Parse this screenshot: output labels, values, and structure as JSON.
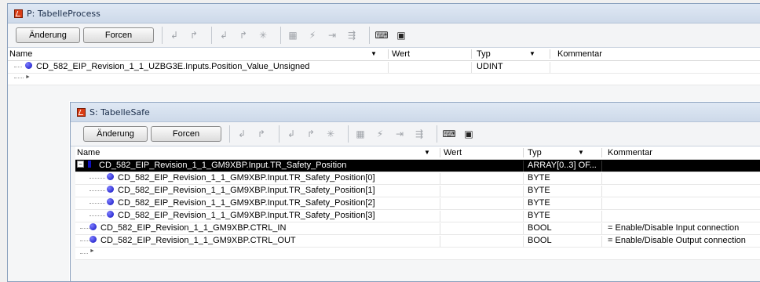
{
  "outer": {
    "title": "P: TabelleProcess",
    "toolbar": {
      "change_label": "Änderung",
      "force_label": "Forcen"
    },
    "columns": {
      "name": "Name",
      "value": "Wert",
      "type": "Typ",
      "comment": "Kommentar"
    },
    "rows": [
      {
        "name": "CD_582_EIP_Revision_1_1_UZBG3E.Inputs.Position_Value_Unsigned",
        "value": "",
        "type": "UDINT",
        "comment": ""
      }
    ]
  },
  "inner": {
    "title": "S: TabelleSafe",
    "toolbar": {
      "change_label": "Änderung",
      "force_label": "Forcen"
    },
    "columns": {
      "name": "Name",
      "value": "Wert",
      "type": "Typ",
      "comment": "Kommentar"
    },
    "rows": [
      {
        "name": "CD_582_EIP_Revision_1_1_GM9XBP.Input.TR_Safety_Position",
        "value": "",
        "type": "ARRAY[0..3] OF...",
        "comment": ""
      },
      {
        "name": "CD_582_EIP_Revision_1_1_GM9XBP.Input.TR_Safety_Position[0]",
        "value": "",
        "type": "BYTE",
        "comment": ""
      },
      {
        "name": "CD_582_EIP_Revision_1_1_GM9XBP.Input.TR_Safety_Position[1]",
        "value": "",
        "type": "BYTE",
        "comment": ""
      },
      {
        "name": "CD_582_EIP_Revision_1_1_GM9XBP.Input.TR_Safety_Position[2]",
        "value": "",
        "type": "BYTE",
        "comment": ""
      },
      {
        "name": "CD_582_EIP_Revision_1_1_GM9XBP.Input.TR_Safety_Position[3]",
        "value": "",
        "type": "BYTE",
        "comment": ""
      },
      {
        "name": "CD_582_EIP_Revision_1_1_GM9XBP.CTRL_IN",
        "value": "",
        "type": "BOOL",
        "comment": "= Enable/Disable Input connection"
      },
      {
        "name": "CD_582_EIP_Revision_1_1_GM9XBP.CTRL_OUT",
        "value": "",
        "type": "BOOL",
        "comment": "= Enable/Disable Output connection"
      }
    ]
  },
  "icons": [
    "window-icon",
    "trigger-falling-icon",
    "trigger-rising-icon",
    "star-icon",
    "grid-icon",
    "lightning-icon",
    "step-icon",
    "run-icon",
    "keyboard-icon",
    "rt-icon"
  ],
  "colors": {
    "selected_row_bg": "#000000",
    "variable_dot": "#1010c0",
    "title_gradient_top": "#dfe8f4"
  }
}
